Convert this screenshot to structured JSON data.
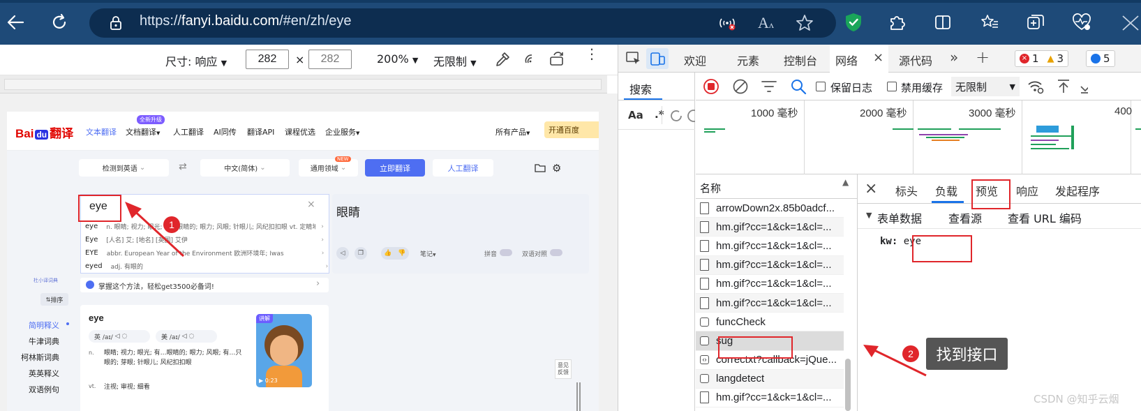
{
  "browser": {
    "url_prefix": "https://",
    "url_domain": "fanyi.baidu.com",
    "url_path": "/#en/zh/eye"
  },
  "device_toolbar": {
    "size_label": "尺寸: 响应",
    "width": "282",
    "height": "282",
    "times": "×",
    "zoom": "200%",
    "throttle": "无限制"
  },
  "baidu": {
    "logo_bai": "Bai",
    "logo_du": "du",
    "logo_fanyi": "翻译",
    "nav": [
      "文本翻译",
      "文档翻译",
      "人工翻译",
      "AI同传",
      "翻译API",
      "课程优选",
      "企业服务"
    ],
    "nav_badge": "全新升级",
    "products": "所有产品",
    "trial": "开通百度",
    "src_lang": "检测到英语",
    "tgt_lang": "中文(简体)",
    "domain": "通用领域",
    "new_badge": "NEW",
    "translate_btn": "立即翻译",
    "human_btn": "人工翻译",
    "input_text": "eye",
    "suggestions": [
      {
        "word": "eye",
        "def": "n. 眼睛; 视力; 眼光; 有…眼睛的; 眼力; 风眼; 针眼儿; 风纪扣扣眼 vt. 定睛地看; 注视; 审视; 细看"
      },
      {
        "word": "Eye",
        "def": "[人名] 艾; [地名] [英国] 艾伊"
      },
      {
        "word": "EYE",
        "def": "abbr. European Year of the Environment 欧洲环境年; Iwas"
      },
      {
        "word": "eyed",
        "def": "adj. 有眼的"
      }
    ],
    "result": "眼睛",
    "notes_label": "笔记",
    "pinyin_label": "拼音",
    "bilingual_label": "双语对照",
    "tip": "掌握这个方法，轻松get3500必备词!",
    "side_small": "杜小译词典",
    "sort": "排序",
    "sidebar": [
      "简明释义",
      "牛津词典",
      "柯林斯词典",
      "英英释义",
      "双语例句"
    ],
    "dict_word": "eye",
    "phon_uk": "英 /aɪ/",
    "phon_us": "美 /aɪ/",
    "def_n_pos": "n.",
    "def_n": "眼睛; 视力; 眼光; 有…眼睛的; 眼力; 风眼; 有…只眼的; 芽眼; 针眼儿; 风纪扣扣眼",
    "def_vt_pos": "vt.",
    "def_vt": "注视; 审视; 细看",
    "video_tag": "讲解",
    "video_time": "0:23",
    "feedback": "意见反馈"
  },
  "devtools": {
    "tabs": [
      "欢迎",
      "元素",
      "控制台",
      "网络",
      "源代码"
    ],
    "errors": "1",
    "warnings": "3",
    "infos": "5",
    "search_tab": "搜索",
    "aa": "Aa",
    "regex": ".*",
    "preserve_log": "保留日志",
    "disable_cache": "禁用缓存",
    "throttle": "无限制",
    "ticks": [
      "1000 毫秒",
      "2000 毫秒",
      "3000 毫秒",
      "400"
    ],
    "name_header": "名称",
    "requests": [
      "arrowDown2x.85b0adcf...",
      "hm.gif?cc=1&ck=1&cl=...",
      "hm.gif?cc=1&ck=1&cl=...",
      "hm.gif?cc=1&ck=1&cl=...",
      "hm.gif?cc=1&ck=1&cl=...",
      "hm.gif?cc=1&ck=1&cl=...",
      "funcCheck",
      "sug",
      "correctxt?callback=jQue...",
      "langdetect",
      "hm.gif?cc=1&ck=1&cl=..."
    ],
    "detail_tabs": [
      "标头",
      "负载",
      "预览",
      "响应",
      "发起程序"
    ],
    "form_data": "表单数据",
    "view_source": "查看源",
    "view_url": "查看 URL 编码",
    "kw_key": "kw:",
    "kw_val": "eye"
  },
  "annotations": {
    "badge1": "1",
    "badge2": "2",
    "callout": "找到接口"
  },
  "watermark": "CSDN @知乎云烟"
}
